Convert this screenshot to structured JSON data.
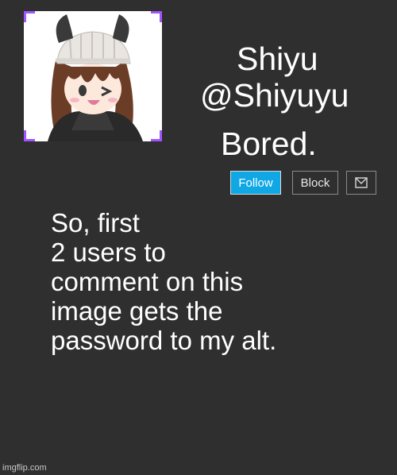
{
  "profile": {
    "display_name": "Shiyu",
    "handle": "@Shiyuyu",
    "status": "Bored."
  },
  "actions": {
    "follow_label": "Follow",
    "block_label": "Block",
    "message_icon": "envelope-icon"
  },
  "post": {
    "lines": [
      "So, first",
      "2 users to",
      "comment on this",
      "image gets the",
      "password to my alt."
    ]
  },
  "watermark": "imgflip.com",
  "colors": {
    "background": "#2f2f2f",
    "follow_button": "#0fa7e4",
    "avatar_frame": "#a154ff",
    "text": "#ffffff"
  }
}
